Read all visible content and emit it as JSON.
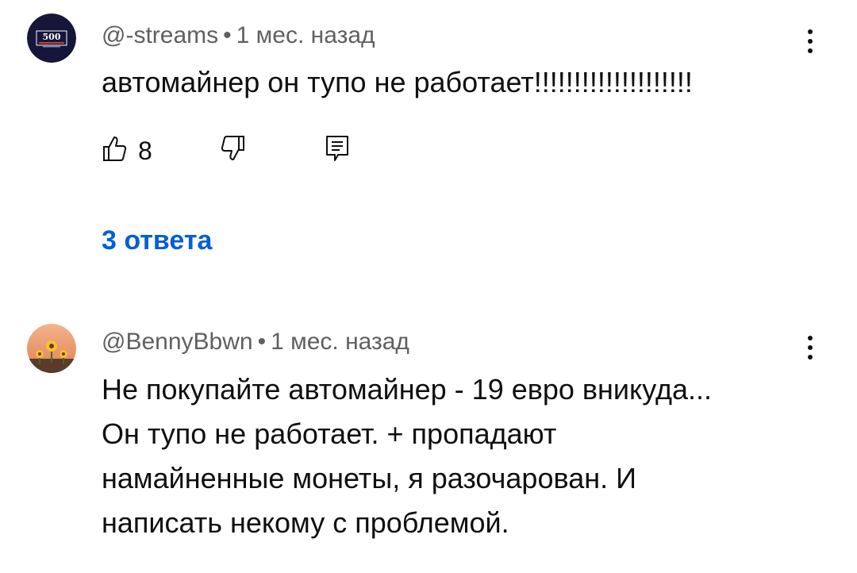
{
  "comments": [
    {
      "author": "@-streams",
      "time": "1 мес. назад",
      "text": "автомайнер он тупо не работает!!!!!!!!!!!!!!!!!!!!",
      "likes": "8",
      "replies_label": "3 ответа",
      "avatar_badge_text": "500",
      "avatar_color": "#16163a"
    },
    {
      "author": "@BennyBbwn",
      "time": "1 мес. назад",
      "text_lines": [
        "Не покупайте автомайнер - 19 евро вникуда...",
        "Он тупо не работает. + пропадают",
        "намайненные монеты, я разочарован. И",
        "написать некому с проблемой."
      ],
      "avatar_color": "#e8956b"
    }
  ],
  "icons": [
    "like-icon",
    "dislike-icon",
    "reply-icon",
    "more-vert-icon"
  ],
  "colors": {
    "link": "#065fd4",
    "meta": "#606060",
    "text": "#0f0f0f"
  }
}
